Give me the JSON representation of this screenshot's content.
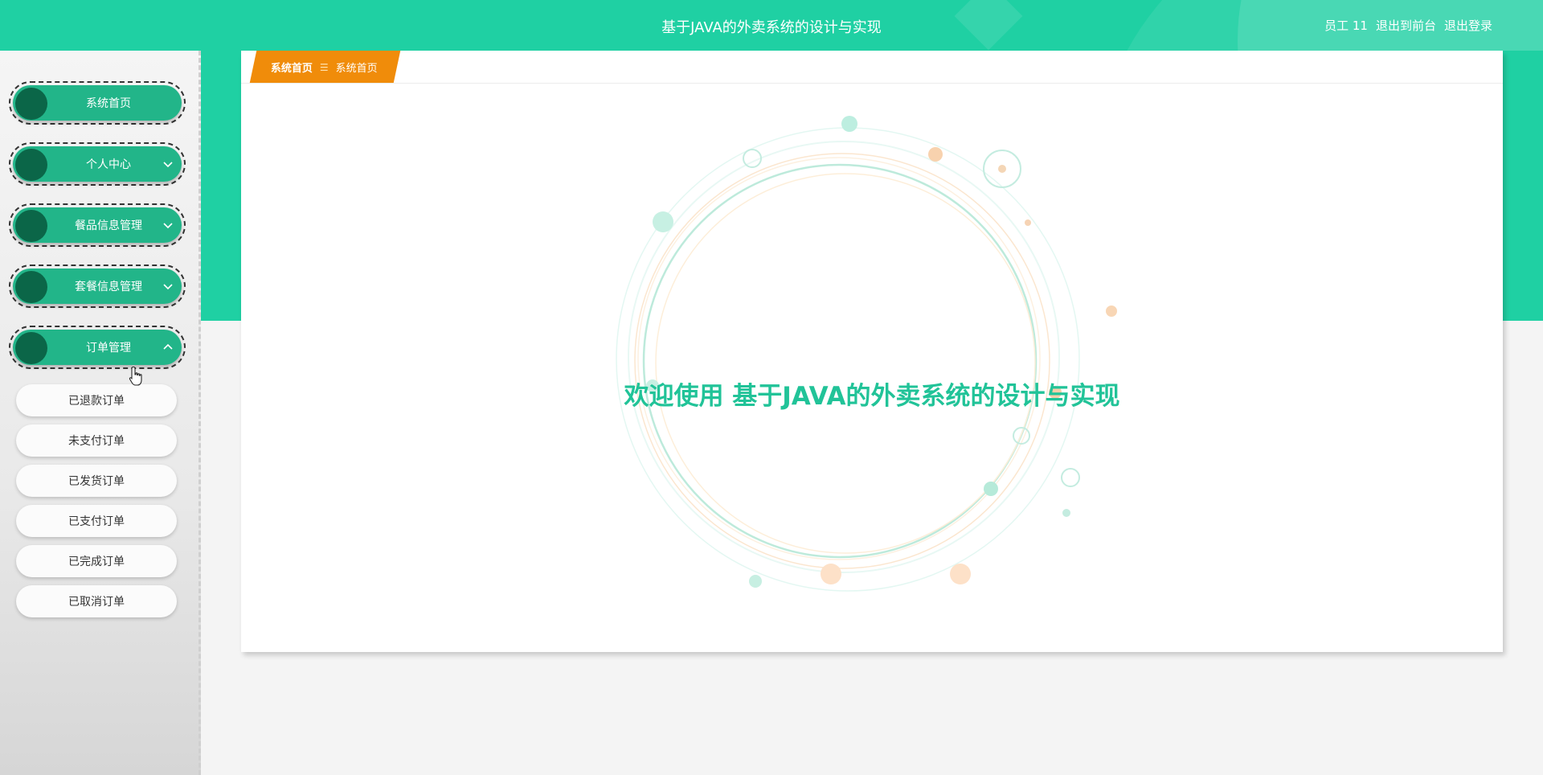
{
  "header": {
    "title": "基于JAVA的外卖系统的设计与实现",
    "user_label": "员工 11",
    "front_link": "退出到前台",
    "logout_link": "退出登录",
    "accent_color": "#1fd0a3"
  },
  "sidebar": {
    "items": [
      {
        "label": "系统首页",
        "icon": "none"
      },
      {
        "label": "个人中心",
        "icon": "chevron-down-icon"
      },
      {
        "label": "餐品信息管理",
        "icon": "chevron-down-icon"
      },
      {
        "label": "套餐信息管理",
        "icon": "chevron-down-icon"
      },
      {
        "label": "订单管理",
        "icon": "chevron-up-icon"
      }
    ],
    "submenu": [
      {
        "label": "已退款订单"
      },
      {
        "label": "未支付订单"
      },
      {
        "label": "已发货订单"
      },
      {
        "label": "已支付订单"
      },
      {
        "label": "已完成订单"
      },
      {
        "label": "已取消订单"
      }
    ]
  },
  "breadcrumb": {
    "home": "系统首页",
    "separator": "☰",
    "current": "系统首页",
    "color": "#f08c0a"
  },
  "main": {
    "welcome": "欢迎使用 基于JAVA的外卖系统的设计与实现",
    "welcome_color": "#21c398"
  }
}
